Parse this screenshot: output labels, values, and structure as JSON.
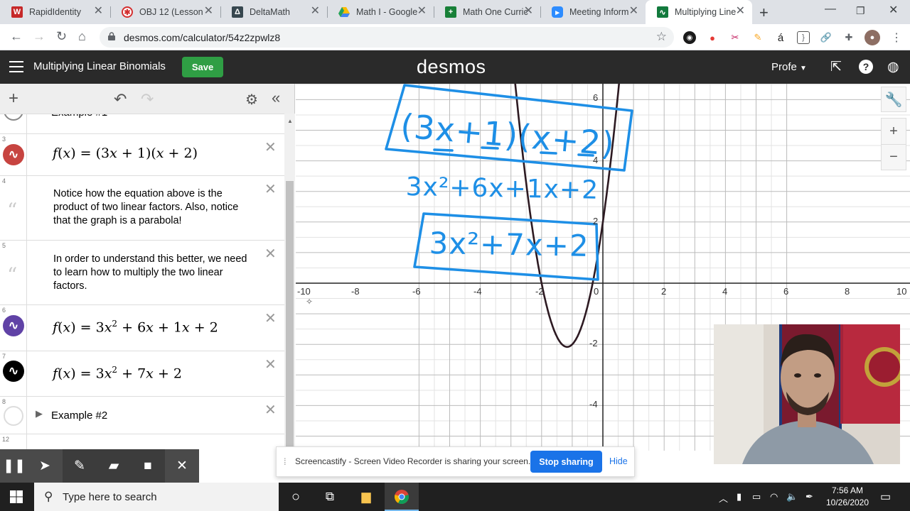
{
  "browser": {
    "tabs": [
      {
        "title": "RapidIdentity",
        "icon": "rapididentity-icon",
        "color": "#c62828"
      },
      {
        "title": "OBJ 12 (Lesson",
        "icon": "lesson-icon",
        "color": "#d32f2f"
      },
      {
        "title": "DeltaMath",
        "icon": "deltamath-icon",
        "color": "#37474f"
      },
      {
        "title": "Math I - Google",
        "icon": "google-drive-icon",
        "color": "#fbbc04"
      },
      {
        "title": "Math One Curric",
        "icon": "google-sheets-icon",
        "color": "#188038"
      },
      {
        "title": "Meeting Inform",
        "icon": "zoom-icon",
        "color": "#2d8cff"
      },
      {
        "title": "Multiplying Line",
        "icon": "desmos-icon",
        "color": "#127a3d"
      }
    ],
    "url": "desmos.com/calculator/54z2zpwlz8"
  },
  "header": {
    "title": "Multiplying Linear Binomials",
    "save_label": "Save",
    "logo": "desmos",
    "profile": "Profe"
  },
  "expressions": {
    "folder_label": "Example #1",
    "rows": [
      {
        "num": "3",
        "kind": "math",
        "color": "#c74440"
      },
      {
        "num": "4",
        "kind": "note",
        "text": "Notice how the equation above is the product of two linear factors. Also, notice that the graph is a parabola!"
      },
      {
        "num": "5",
        "kind": "note",
        "text": "In order to understand this better, we need to learn how to multiply the two linear factors."
      },
      {
        "num": "6",
        "kind": "math",
        "color": "#6042a6"
      },
      {
        "num": "7",
        "kind": "math",
        "color": "#000000"
      },
      {
        "num": "8",
        "kind": "folder",
        "text": "Example #2"
      },
      {
        "num": "12",
        "kind": "empty"
      }
    ],
    "f_label": "f",
    "x_var": "x",
    "math3": [
      "(3",
      "+ 1)(",
      "+ 2)"
    ],
    "math6": [
      "3",
      "2",
      "+ 6",
      "+ 1",
      "+ 2"
    ],
    "math7": [
      "3",
      "2",
      "+ 7",
      "+ 2"
    ]
  },
  "graph": {
    "x_ticks": [
      "-10",
      "-8",
      "-6",
      "-4",
      "-2",
      "0",
      "2",
      "4",
      "6",
      "8",
      "10"
    ],
    "y_ticks": [
      "6",
      "4",
      "2",
      "-2",
      "-4"
    ],
    "curve_color": "#2d1a22",
    "ink_color": "#1e8fe6",
    "handwriting": {
      "line1": "(3x+1)(x+2)",
      "line2": "3x²+6x+1x+2",
      "line3": "3x²+7x+2"
    }
  },
  "screencastify": {
    "share_text": "Screencastify - Screen Video Recorder is sharing your screen.",
    "stop_label": "Stop sharing",
    "hide_label": "Hide"
  },
  "taskbar": {
    "search_placeholder": "Type here to search",
    "time": "7:56 AM",
    "date": "10/26/2020"
  }
}
